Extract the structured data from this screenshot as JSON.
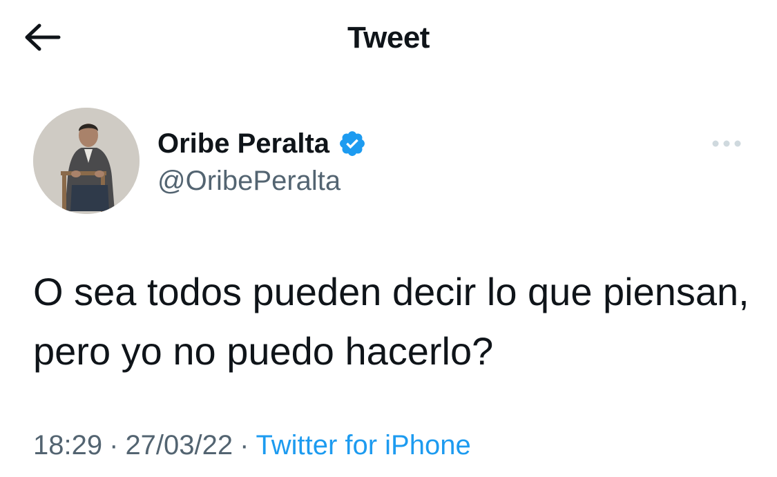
{
  "header": {
    "title": "Tweet",
    "back_icon": "arrow-left-icon"
  },
  "author": {
    "name": "Oribe Peralta",
    "handle": "@OribePeralta",
    "verified": true,
    "verified_icon": "verified-badge-icon",
    "avatar_icon": "avatar-photo"
  },
  "tweet": {
    "text": "O sea todos pueden decir lo que piensan, pero yo no puedo hacerlo?",
    "time": "18:29",
    "separator": "·",
    "date": "27/03/22",
    "source": "Twitter for iPhone"
  },
  "actions": {
    "more_icon": "more-horizontal-icon"
  },
  "colors": {
    "accent": "#1d9bf0",
    "secondary_text": "#536471",
    "primary_text": "#0f1419",
    "more_dots": "#cfd9de"
  }
}
